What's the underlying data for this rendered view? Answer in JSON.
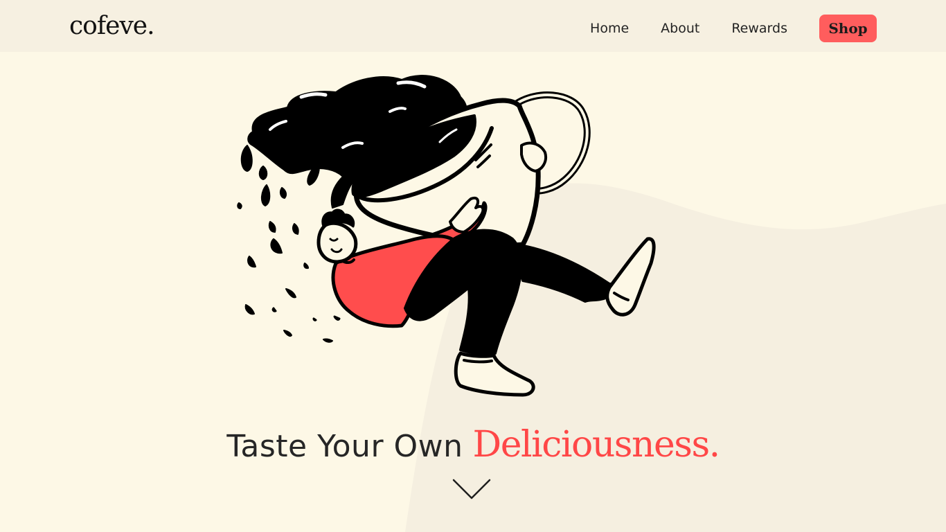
{
  "brand": {
    "logo_text": "cofeve."
  },
  "nav": {
    "items": [
      {
        "label": "Home"
      },
      {
        "label": "About"
      },
      {
        "label": "Rewards"
      }
    ],
    "cta_label": "Shop"
  },
  "hero": {
    "headline_main": "Taste Your Own",
    "headline_accent": "Deliciousness.",
    "scroll_icon": "chevron-down-icon",
    "illustration": "person-hugging-coffee-cup-illustration"
  },
  "colors": {
    "background": "#fdf8e6",
    "header_background": "#f6f0e1",
    "accent": "#ff4747",
    "cta_background": "#ff5d5d",
    "text": "#262626"
  }
}
